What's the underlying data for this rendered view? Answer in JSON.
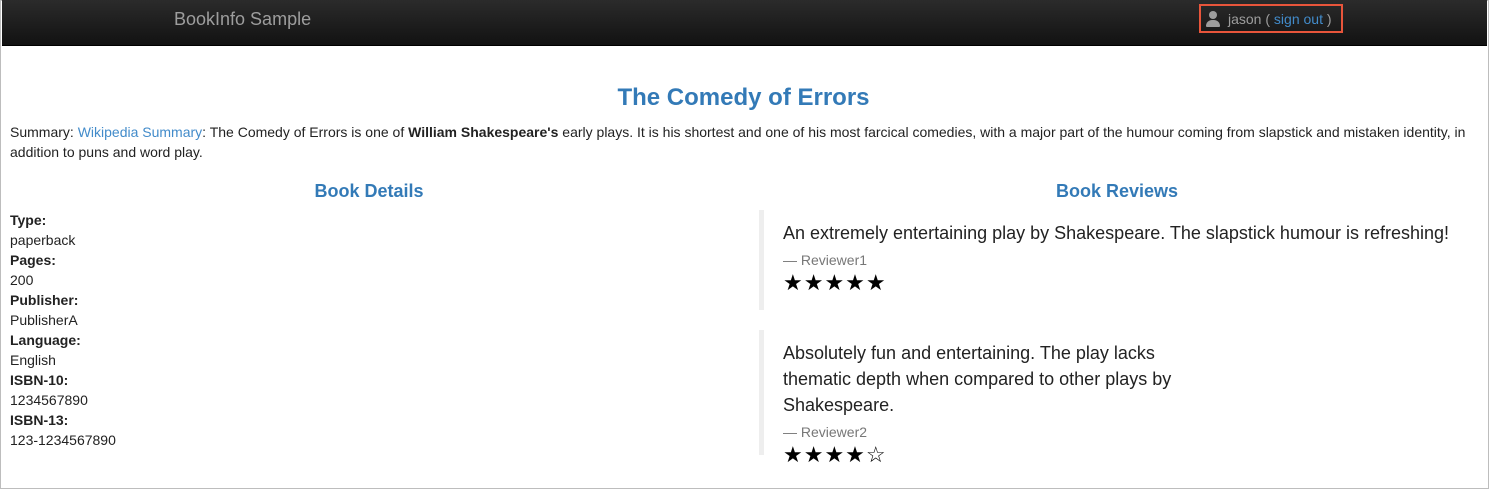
{
  "navbar": {
    "brand": "BookInfo Sample",
    "user": {
      "icon": "user-icon",
      "name": "jason",
      "open_paren": " ( ",
      "sign_out": "sign out",
      "close_paren": " )"
    }
  },
  "book": {
    "title": "The Comedy of Errors",
    "summary": {
      "label": "Summary: ",
      "link": "Wikipedia Summary",
      "text1": ": The Comedy of Errors is one of ",
      "bold": "William Shakespeare's",
      "text2": " early plays. It is his shortest and one of his most farcical comedies, with a major part of the humour coming from slapstick and mistaken identity, in addition to puns and word play."
    }
  },
  "details": {
    "heading": "Book Details",
    "items": [
      {
        "label": "Type:",
        "value": "paperback"
      },
      {
        "label": "Pages:",
        "value": "200"
      },
      {
        "label": "Publisher:",
        "value": "PublisherA"
      },
      {
        "label": "Language:",
        "value": "English"
      },
      {
        "label": "ISBN-10:",
        "value": "1234567890"
      },
      {
        "label": "ISBN-13:",
        "value": "123-1234567890"
      }
    ]
  },
  "reviews": {
    "heading": "Book Reviews",
    "items": [
      {
        "text": "An extremely entertaining play by Shakespeare. The slapstick humour is refreshing!",
        "author": "— Reviewer1",
        "stars": "★★★★★",
        "rating": 5
      },
      {
        "text": "Absolutely fun and entertaining. The play lacks thematic depth when compared to other plays by Shakespeare.",
        "author": "— Reviewer2",
        "stars": "★★★★☆",
        "rating": 4
      }
    ]
  }
}
